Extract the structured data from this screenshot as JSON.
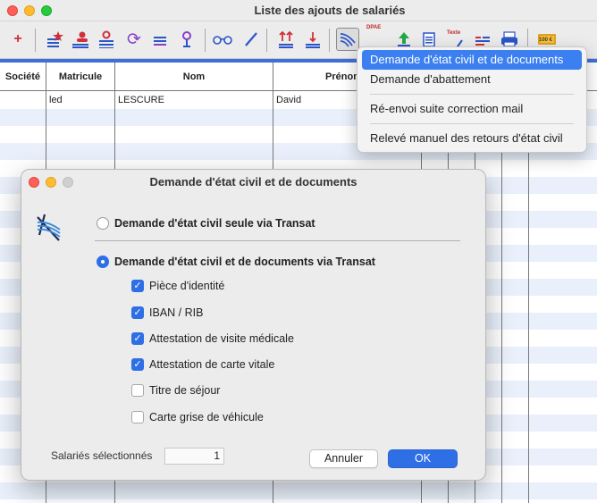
{
  "window": {
    "title": "Liste des ajouts de salariés"
  },
  "toolbar": {
    "texte_badge": "Texte",
    "dpae_badge": "DPAE",
    "cent_badge": "100 €"
  },
  "grid": {
    "columns": [
      "Société",
      "Matricule",
      "Nom",
      "Prénom"
    ],
    "rows": [
      {
        "societe": "",
        "matricule": "led",
        "nom": "LESCURE",
        "prenom": "David"
      }
    ]
  },
  "menu": {
    "items": [
      "Demande d'état civil et de documents",
      "Demande d'abattement",
      "Ré-envoi suite correction mail",
      "Relevé manuel des retours d'état civil"
    ]
  },
  "dialog": {
    "title": "Demande d'état civil et de documents",
    "radio_simple": "Demande d'état civil seule via Transat",
    "radio_full": "Demande d'état civil et de documents via Transat",
    "selected_radio": "full",
    "documents": [
      {
        "label": "Pièce d'identité",
        "checked": true
      },
      {
        "label": "IBAN / RIB",
        "checked": true
      },
      {
        "label": "Attestation de visite médicale",
        "checked": true
      },
      {
        "label": "Attestation de carte vitale",
        "checked": true
      },
      {
        "label": "Titre de séjour",
        "checked": false
      },
      {
        "label": "Carte grise de véhicule",
        "checked": false
      }
    ],
    "count_label": "Salariés sélectionnés",
    "count_value": "1",
    "cancel_label": "Annuler",
    "ok_label": "OK"
  },
  "colors": {
    "accent": "#2f6fe6",
    "stripe": "#e9f0fb",
    "header_band": "#3f70d8"
  }
}
